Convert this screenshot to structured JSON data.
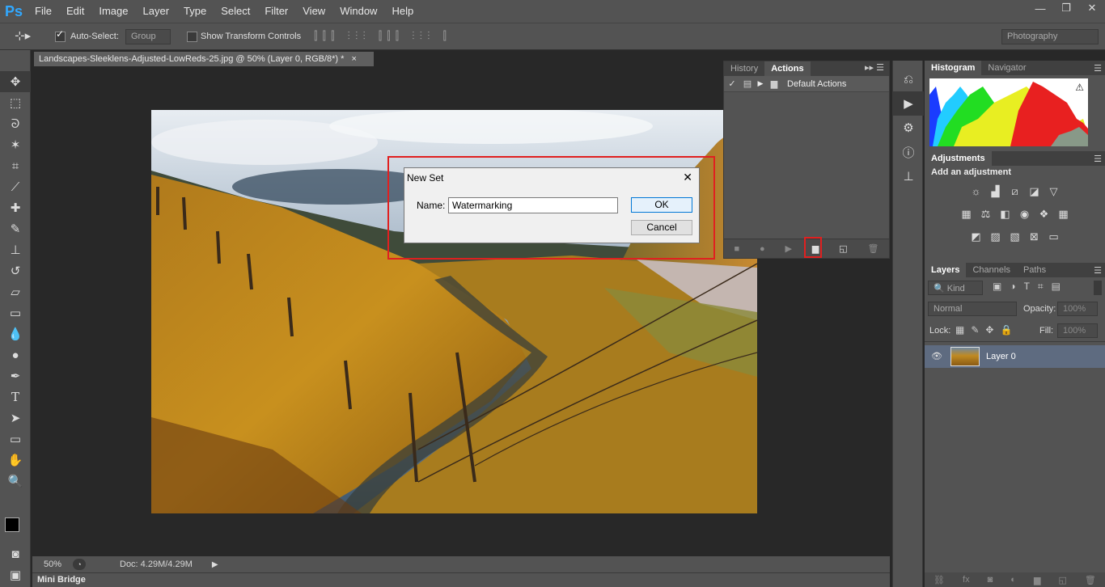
{
  "app": {
    "logo": "Ps"
  },
  "menu": [
    "File",
    "Edit",
    "Image",
    "Layer",
    "Type",
    "Select",
    "Filter",
    "View",
    "Window",
    "Help"
  ],
  "window_controls": [
    "—",
    "❐",
    "✕"
  ],
  "options": {
    "auto_select_label": "Auto-Select:",
    "auto_select_value": "Group",
    "show_transform_label": "Show Transform Controls",
    "workspace": "Photography"
  },
  "document": {
    "tab_title": "Landscapes-Sleeklens-Adjusted-LowReds-25.jpg @ 50% (Layer 0, RGB/8*) *",
    "close": "×"
  },
  "status": {
    "zoom": "50%",
    "doc_info": "Doc: 4.29M/4.29M"
  },
  "minibridge": {
    "label": "Mini Bridge"
  },
  "actions_panel": {
    "tabs": [
      "History",
      "Actions"
    ],
    "item": "Default Actions"
  },
  "dialog": {
    "title": "New Set",
    "name_label": "Name:",
    "name_value": "Watermarking",
    "ok": "OK",
    "cancel": "Cancel",
    "close": "✕"
  },
  "histogram": {
    "tabs": [
      "Histogram",
      "Navigator"
    ],
    "warning": "⚠"
  },
  "adjustments": {
    "tab": "Adjustments",
    "heading": "Add an adjustment"
  },
  "layers": {
    "tabs": [
      "Layers",
      "Channels",
      "Paths"
    ],
    "kind": "Kind",
    "blend": "Normal",
    "opacity_label": "Opacity:",
    "opacity_value": "100%",
    "lock_label": "Lock:",
    "fill_label": "Fill:",
    "fill_value": "100%",
    "layer_name": "Layer 0"
  },
  "colors": {
    "accent": "#31a8ff",
    "highlight": "#e02020"
  }
}
